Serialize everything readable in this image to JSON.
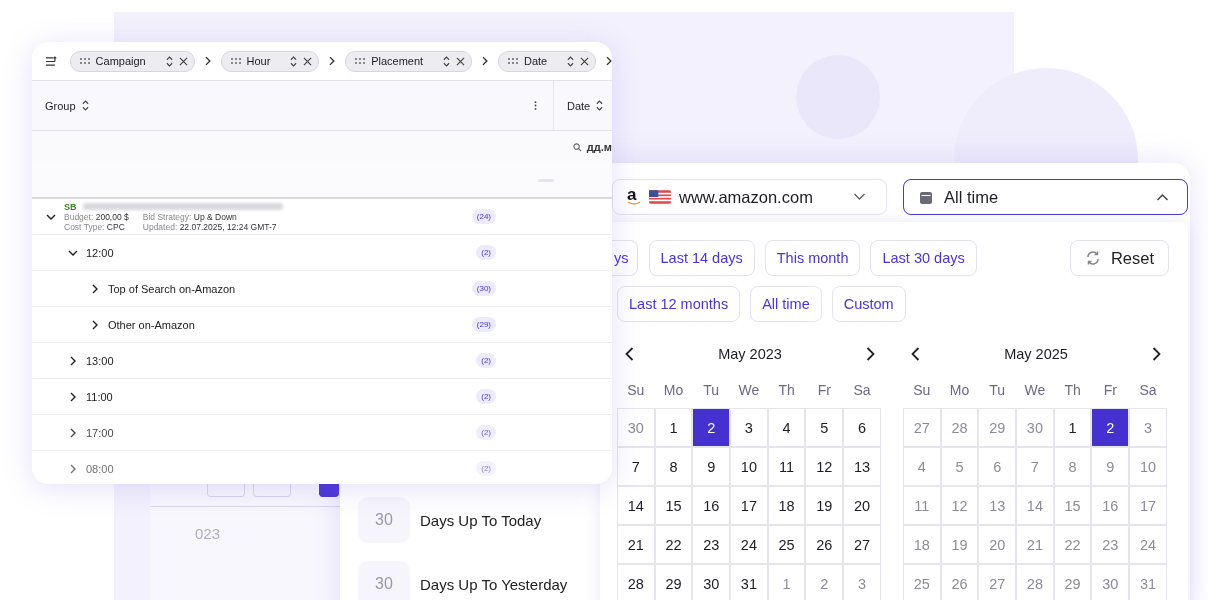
{
  "back_panel": {
    "chips": [
      {
        "selected": false
      },
      {
        "selected": false
      },
      {
        "selected": true
      }
    ],
    "year": "023"
  },
  "table": {
    "group_chips": [
      {
        "label": "Campaign"
      },
      {
        "label": "Hour"
      },
      {
        "label": "Placement"
      },
      {
        "label": "Date"
      }
    ],
    "columns": [
      {
        "label": "Group"
      },
      {
        "label": "Date"
      }
    ],
    "filter_placeholder": "дд.м",
    "rows": [
      {
        "kind": "campaign",
        "expanded": true,
        "type": "SB",
        "details": [
          {
            "label": "Budget:",
            "value": "200,00 $"
          },
          {
            "label": "Bid Strategy:",
            "value": "Up & Down"
          },
          {
            "label": "Cost Type:",
            "value": "CPC"
          },
          {
            "label": "Updated:",
            "value": "22.07.2025, 12:24 GMT-7"
          }
        ],
        "count": "(24)",
        "children": [
          {
            "kind": "group",
            "label": "12:00",
            "expanded": true,
            "count": "(2)",
            "children": [
              {
                "kind": "group",
                "label": "Top of Search on-Amazon",
                "expanded": false,
                "count": "(30)"
              },
              {
                "kind": "group",
                "label": "Other on-Amazon",
                "expanded": false,
                "count": "(29)"
              }
            ]
          },
          {
            "kind": "group",
            "label": "13:00",
            "expanded": false,
            "count": "(2)"
          },
          {
            "kind": "group",
            "label": "11:00",
            "expanded": false,
            "count": "(2)"
          },
          {
            "kind": "group",
            "label": "17:00",
            "expanded": false,
            "count": "(2)"
          },
          {
            "kind": "group",
            "label": "08:00",
            "expanded": false,
            "count": "(2)"
          }
        ]
      }
    ]
  },
  "date_picker": {
    "quick_ranges": [
      {
        "count": "30",
        "label": "Days Up To Today"
      },
      {
        "count": "30",
        "label": "Days Up To Yesterday"
      }
    ],
    "marketplace": {
      "logo": "a",
      "value": "www.amazon.com"
    },
    "date_select": {
      "value": "All time",
      "expanded": true
    },
    "preset_rows": [
      [
        {
          "label": "ys"
        },
        {
          "label": "Last 14 days"
        },
        {
          "label": "This month"
        },
        {
          "label": "Last 30 days"
        }
      ],
      [
        {
          "label": "Last 12 months"
        },
        {
          "label": "All time"
        },
        {
          "label": "Custom"
        }
      ]
    ],
    "reset": "Reset",
    "calendars": [
      {
        "title": "May 2023",
        "weekdays": [
          "Su",
          "Mo",
          "Tu",
          "We",
          "Th",
          "Fr",
          "Sa"
        ],
        "weeks": [
          [
            {
              "d": "30",
              "muted": true,
              "selected": false
            },
            {
              "d": "1",
              "muted": false,
              "selected": false
            },
            {
              "d": "2",
              "muted": false,
              "selected": true
            },
            {
              "d": "3",
              "muted": false,
              "selected": false
            },
            {
              "d": "4",
              "muted": false,
              "selected": false
            },
            {
              "d": "5",
              "muted": false,
              "selected": false
            },
            {
              "d": "6",
              "muted": false,
              "selected": false
            }
          ],
          [
            {
              "d": "7",
              "muted": false,
              "selected": false
            },
            {
              "d": "8",
              "muted": false,
              "selected": false
            },
            {
              "d": "9",
              "muted": false,
              "selected": false
            },
            {
              "d": "10",
              "muted": false,
              "selected": false
            },
            {
              "d": "11",
              "muted": false,
              "selected": false
            },
            {
              "d": "12",
              "muted": false,
              "selected": false
            },
            {
              "d": "13",
              "muted": false,
              "selected": false
            }
          ],
          [
            {
              "d": "14",
              "muted": false,
              "selected": false
            },
            {
              "d": "15",
              "muted": false,
              "selected": false
            },
            {
              "d": "16",
              "muted": false,
              "selected": false
            },
            {
              "d": "17",
              "muted": false,
              "selected": false
            },
            {
              "d": "18",
              "muted": false,
              "selected": false
            },
            {
              "d": "19",
              "muted": false,
              "selected": false
            },
            {
              "d": "20",
              "muted": false,
              "selected": false
            }
          ],
          [
            {
              "d": "21",
              "muted": false,
              "selected": false
            },
            {
              "d": "22",
              "muted": false,
              "selected": false
            },
            {
              "d": "23",
              "muted": false,
              "selected": false
            },
            {
              "d": "24",
              "muted": false,
              "selected": false
            },
            {
              "d": "25",
              "muted": false,
              "selected": false
            },
            {
              "d": "26",
              "muted": false,
              "selected": false
            },
            {
              "d": "27",
              "muted": false,
              "selected": false
            }
          ],
          [
            {
              "d": "28",
              "muted": false,
              "selected": false
            },
            {
              "d": "29",
              "muted": false,
              "selected": false
            },
            {
              "d": "30",
              "muted": false,
              "selected": false
            },
            {
              "d": "31",
              "muted": false,
              "selected": false
            },
            {
              "d": "1",
              "muted": true,
              "selected": false
            },
            {
              "d": "2",
              "muted": true,
              "selected": false
            },
            {
              "d": "3",
              "muted": true,
              "selected": false
            }
          ]
        ]
      },
      {
        "title": "May 2025",
        "weekdays": [
          "Su",
          "Mo",
          "Tu",
          "We",
          "Th",
          "Fr",
          "Sa"
        ],
        "weeks": [
          [
            {
              "d": "27",
              "muted": true,
              "selected": false
            },
            {
              "d": "28",
              "muted": true,
              "selected": false
            },
            {
              "d": "29",
              "muted": true,
              "selected": false
            },
            {
              "d": "30",
              "muted": true,
              "selected": false
            },
            {
              "d": "1",
              "muted": false,
              "selected": false
            },
            {
              "d": "2",
              "muted": false,
              "selected": true
            },
            {
              "d": "3",
              "muted": true,
              "selected": false
            }
          ],
          [
            {
              "d": "4",
              "muted": true,
              "selected": false
            },
            {
              "d": "5",
              "muted": true,
              "selected": false
            },
            {
              "d": "6",
              "muted": true,
              "selected": false
            },
            {
              "d": "7",
              "muted": true,
              "selected": false
            },
            {
              "d": "8",
              "muted": true,
              "selected": false
            },
            {
              "d": "9",
              "muted": true,
              "selected": false
            },
            {
              "d": "10",
              "muted": true,
              "selected": false
            }
          ],
          [
            {
              "d": "11",
              "muted": true,
              "selected": false
            },
            {
              "d": "12",
              "muted": true,
              "selected": false
            },
            {
              "d": "13",
              "muted": true,
              "selected": false
            },
            {
              "d": "14",
              "muted": true,
              "selected": false
            },
            {
              "d": "15",
              "muted": true,
              "selected": false
            },
            {
              "d": "16",
              "muted": true,
              "selected": false
            },
            {
              "d": "17",
              "muted": true,
              "selected": false
            }
          ],
          [
            {
              "d": "18",
              "muted": true,
              "selected": false
            },
            {
              "d": "19",
              "muted": true,
              "selected": false
            },
            {
              "d": "20",
              "muted": true,
              "selected": false
            },
            {
              "d": "21",
              "muted": true,
              "selected": false
            },
            {
              "d": "22",
              "muted": true,
              "selected": false
            },
            {
              "d": "23",
              "muted": true,
              "selected": false
            },
            {
              "d": "24",
              "muted": true,
              "selected": false
            }
          ],
          [
            {
              "d": "25",
              "muted": true,
              "selected": false
            },
            {
              "d": "26",
              "muted": true,
              "selected": false
            },
            {
              "d": "27",
              "muted": true,
              "selected": false
            },
            {
              "d": "28",
              "muted": true,
              "selected": false
            },
            {
              "d": "29",
              "muted": true,
              "selected": false
            },
            {
              "d": "30",
              "muted": true,
              "selected": false
            },
            {
              "d": "31",
              "muted": true,
              "selected": false
            }
          ]
        ]
      }
    ]
  }
}
